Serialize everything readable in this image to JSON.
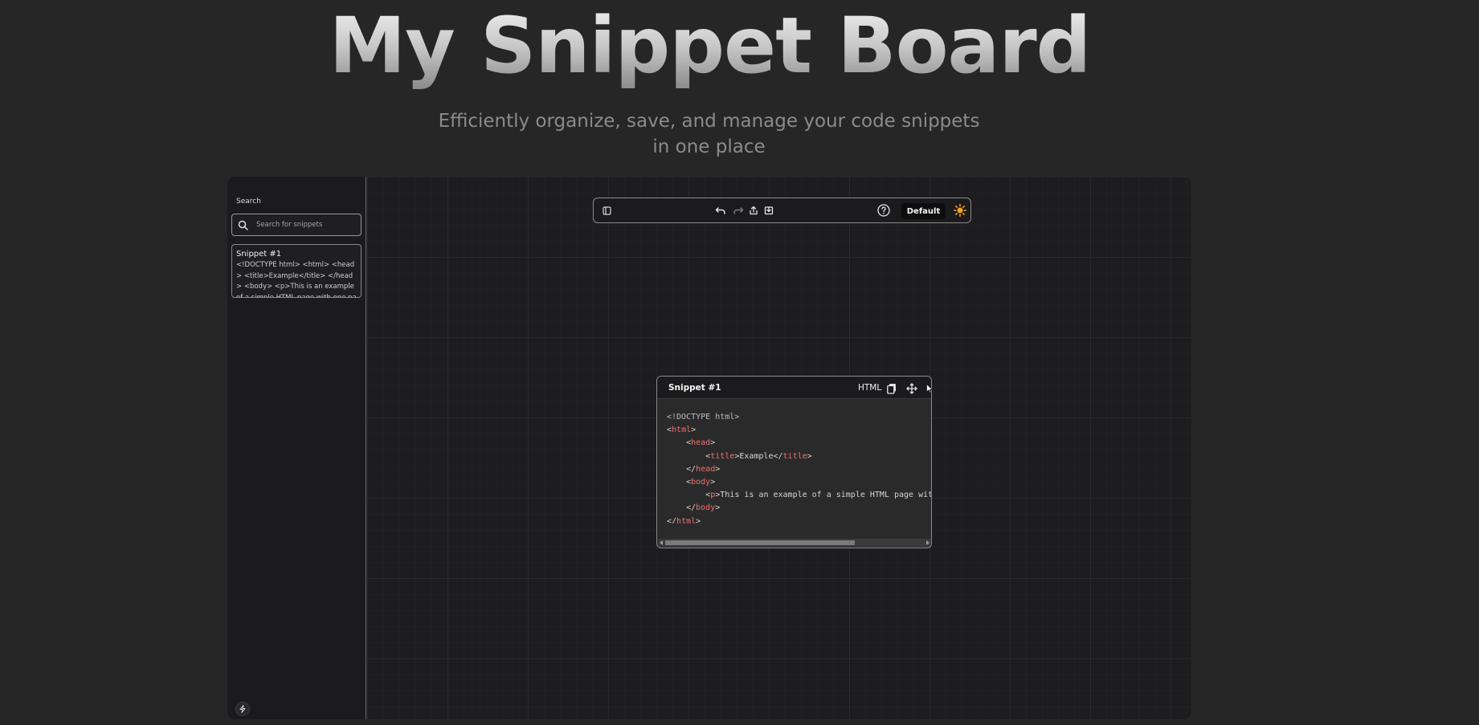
{
  "hero": {
    "title": "My Snippet Board",
    "subtitle": "Efficiently organize, save, and manage your code snippets in one place"
  },
  "sidebar": {
    "search_label": "Search",
    "search_placeholder": "Search for snippets",
    "search_value": "",
    "snippets": [
      {
        "title": "Snippet #1",
        "preview": "<!DOCTYPE html> <html> <head> <title>Example</title> </head> <body> <p>This is an example of a simple HTML page with one paragraph.</p> </body> </html>"
      }
    ]
  },
  "toolbar": {
    "theme_label": "Default"
  },
  "snippet_window": {
    "title": "Snippet #1",
    "language": "HTML",
    "code_lines": [
      {
        "indent": "",
        "parts": [
          {
            "t": "<!DOCTYPE html>",
            "c": "doctype"
          }
        ]
      },
      {
        "indent": "",
        "parts": [
          {
            "t": "<",
            "c": ""
          },
          {
            "t": "html",
            "c": "tag"
          },
          {
            "t": ">",
            "c": ""
          }
        ]
      },
      {
        "indent": "    ",
        "parts": [
          {
            "t": "<",
            "c": ""
          },
          {
            "t": "head",
            "c": "tag"
          },
          {
            "t": ">",
            "c": ""
          }
        ]
      },
      {
        "indent": "        ",
        "parts": [
          {
            "t": "<",
            "c": ""
          },
          {
            "t": "title",
            "c": "tag"
          },
          {
            "t": ">Example</",
            "c": ""
          },
          {
            "t": "title",
            "c": "tag"
          },
          {
            "t": ">",
            "c": ""
          }
        ]
      },
      {
        "indent": "    ",
        "parts": [
          {
            "t": "</",
            "c": ""
          },
          {
            "t": "head",
            "c": "tag"
          },
          {
            "t": ">",
            "c": ""
          }
        ]
      },
      {
        "indent": "    ",
        "parts": [
          {
            "t": "<",
            "c": ""
          },
          {
            "t": "body",
            "c": "tag"
          },
          {
            "t": ">",
            "c": ""
          }
        ]
      },
      {
        "indent": "        ",
        "parts": [
          {
            "t": "<",
            "c": ""
          },
          {
            "t": "p",
            "c": "tag"
          },
          {
            "t": ">This is an example of a simple HTML page with one paragraph.</",
            "c": ""
          },
          {
            "t": "p",
            "c": "tag"
          },
          {
            "t": ">",
            "c": ""
          }
        ]
      },
      {
        "indent": "    ",
        "parts": [
          {
            "t": "</",
            "c": ""
          },
          {
            "t": "body",
            "c": "tag"
          },
          {
            "t": ">",
            "c": ""
          }
        ]
      },
      {
        "indent": "",
        "parts": [
          {
            "t": "</",
            "c": ""
          },
          {
            "t": "html",
            "c": "tag"
          },
          {
            "t": ">",
            "c": ""
          }
        ]
      }
    ]
  },
  "icons": {
    "sidebar_toggle": "sidebar-toggle-icon",
    "undo": "undo-icon",
    "redo": "redo-icon",
    "export": "export-icon",
    "import": "import-icon",
    "help": "help-icon",
    "theme": "sun-icon",
    "copy": "copy-icon",
    "move": "move-icon",
    "bolt": "bolt-icon"
  },
  "colors": {
    "background": "#262626",
    "panel": "#1b1b1d",
    "tag": "#f0716f",
    "sun": "#f5a524"
  }
}
